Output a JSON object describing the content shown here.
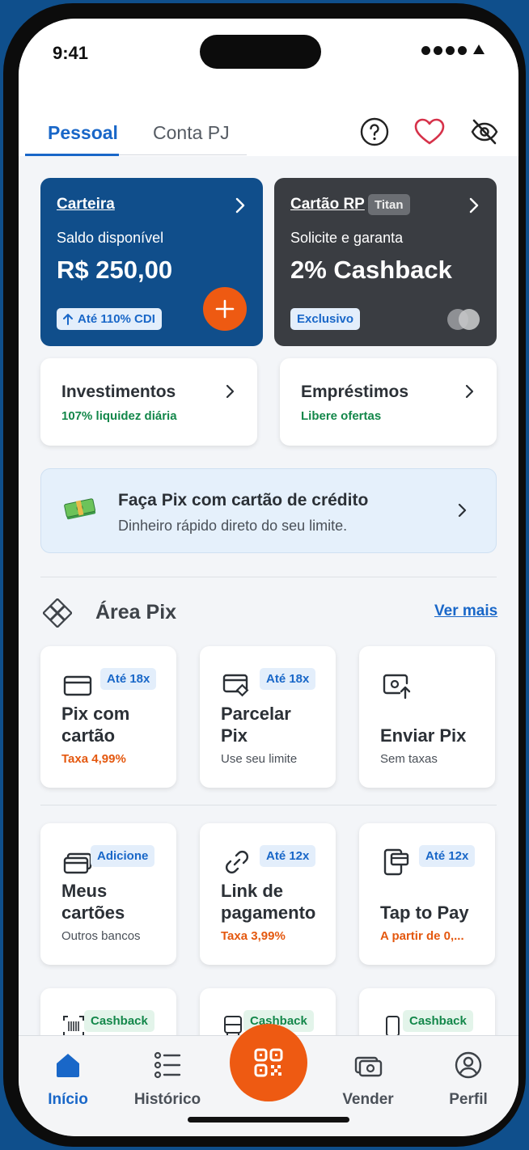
{
  "status_bar": {
    "time": "9:41"
  },
  "tabs": [
    {
      "label": "Pessoal",
      "active": true
    },
    {
      "label": "Conta PJ",
      "active": false
    }
  ],
  "top_icons": [
    "help-circle-icon",
    "heart-icon",
    "eye-off-icon"
  ],
  "wallet_card": {
    "title": "Carteira",
    "subtitle": "Saldo disponível",
    "balance": "R$ 250,00",
    "badge": "Até 110% CDI",
    "color": "#104e8b"
  },
  "credit_card": {
    "title": "Cartão RP",
    "tier": "Titan",
    "subtitle": "Solicite e garanta",
    "headline": "2% Cashback",
    "badge": "Exclusivo",
    "color": "#3a3d42"
  },
  "investments": {
    "title": "Investimentos",
    "subtitle": "107% liquidez diária"
  },
  "loans": {
    "title": "Empréstimos",
    "subtitle": "Libere ofertas"
  },
  "promo": {
    "title": "Faça Pix com cartão de crédito",
    "subtitle": "Dinheiro rápido direto do seu limite."
  },
  "pix_section": {
    "title": "Área Pix",
    "see_more": "Ver mais"
  },
  "tiles": [
    {
      "badge": "Até 18x",
      "title1": "Pix com",
      "title2": "cartão",
      "sub": "Taxa 4,99%"
    },
    {
      "badge": "Até 18x",
      "title1": "Parcelar",
      "title2": "Pix",
      "sub": "Use seu limite"
    },
    {
      "title1": "Enviar Pix",
      "sub": "Sem taxas"
    },
    {
      "badge": "Adicione",
      "title1": "Meus",
      "title2": "cartões",
      "sub": "Outros bancos"
    },
    {
      "badge": "Até 12x",
      "title1": "Link de",
      "title2": "pagamento",
      "sub": "Taxa 3,99%"
    },
    {
      "badge": "Até 12x",
      "title1": "Tap to Pay",
      "sub": "A partir de 0,..."
    },
    {
      "badge": "Cashback"
    },
    {
      "badge": "Cashback"
    },
    {
      "badge": "Cashback"
    }
  ],
  "bottom_nav": [
    {
      "label": "Início",
      "active": true
    },
    {
      "label": "Histórico",
      "active": false
    },
    {
      "label": "Vender",
      "active": false
    },
    {
      "label": "Perfil",
      "active": false
    }
  ],
  "colors": {
    "accent": "#1967c8",
    "orange": "#ee5a12",
    "green": "#13874a"
  }
}
